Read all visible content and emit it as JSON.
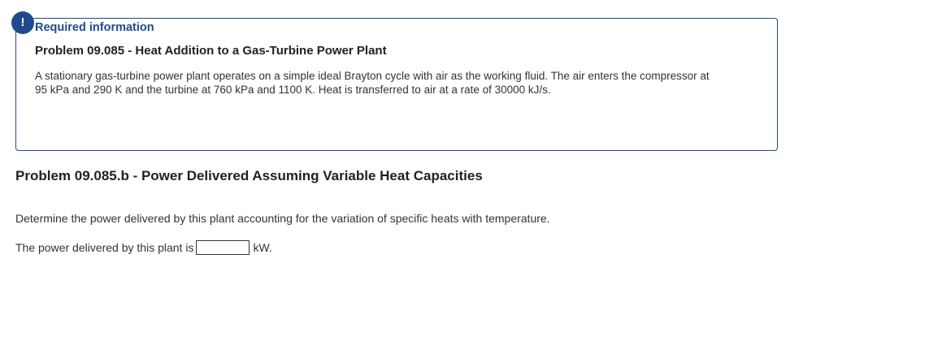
{
  "alert": {
    "icon_glyph": "!",
    "icon_name": "exclamation-icon",
    "color": "#1f4b8e"
  },
  "info_box": {
    "required_label": "Required information",
    "problem_title": "Problem 09.085 - Heat Addition to a Gas-Turbine Power Plant",
    "description": "A stationary gas-turbine power plant operates on a simple ideal Brayton cycle with air as the working fluid. The air enters the compressor at 95 kPa and 290 K and the turbine at 760 kPa and 1100 K. Heat is transferred to air at a rate of 30000 kJ/s."
  },
  "part": {
    "title": "Problem 09.085.b - Power Delivered Assuming Variable Heat Capacities",
    "question": "Determine the power delivered by this plant accounting for the variation of specific heats with temperature.",
    "answer_prefix": "The power delivered by this plant is",
    "answer_value": "",
    "answer_unit": "kW."
  }
}
